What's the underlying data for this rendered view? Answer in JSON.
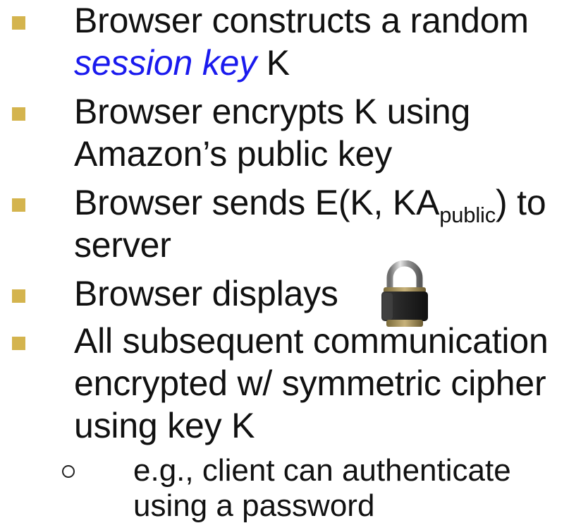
{
  "bullets": [
    {
      "line1": "Browser constructs a random",
      "line2_em": "session key",
      "line2_rest": " K"
    },
    {
      "line1": "Browser encrypts K using",
      "line2": "Amazon’s public key"
    },
    {
      "line1_pre": "Browser sends E(K, KA",
      "line1_sub": "public",
      "line1_post": ") to",
      "line2": "server"
    },
    {
      "line1": "Browser displays"
    },
    {
      "line1": "All subsequent communication",
      "line2": "encrypted w/ symmetric cipher",
      "line3": "using key K"
    }
  ],
  "sub_bullet": {
    "line1": "e.g., client can authenticate",
    "line2": "using a password"
  },
  "colors": {
    "bullet": "#d4b44e",
    "emphasis": "#1a1aee"
  },
  "icons": {
    "lock": "padlock-icon"
  }
}
